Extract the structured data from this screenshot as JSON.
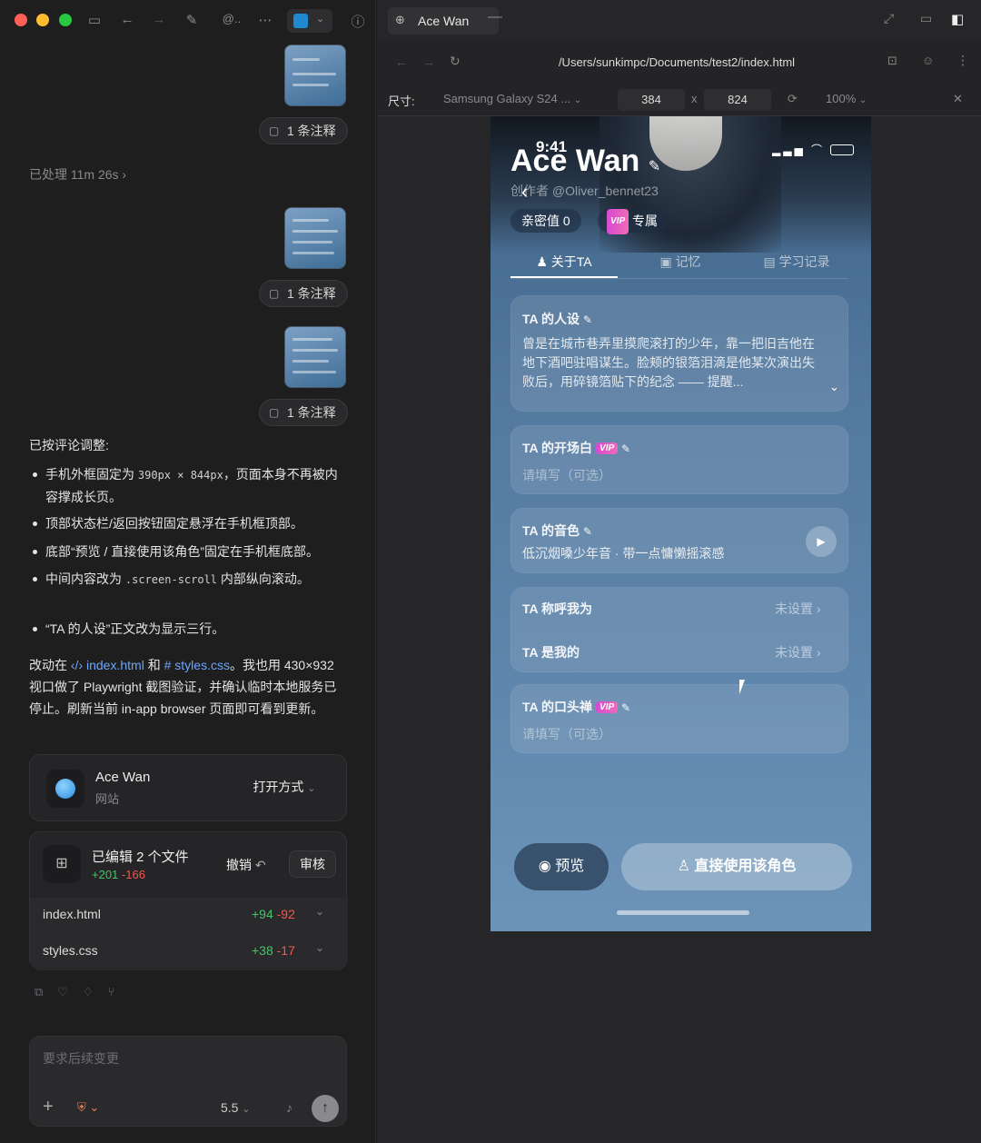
{
  "app": {
    "tab_title": "Ace Wan",
    "url": "/Users/sunkimpc/Documents/test2/index.html"
  },
  "device": {
    "label": "尺寸:",
    "model": "Samsung Galaxy S24 ...",
    "width": "384",
    "times": "x",
    "height": "824",
    "zoom": "100%"
  },
  "left": {
    "comment_label": "1 条注释",
    "processed": "已处理 11m 26s",
    "summary_title": "已按评论调整:",
    "bullets": [
      {
        "pre": "手机外框固定为 ",
        "code": "390px × 844px",
        "post": "，页面本身不再被内容撑成长页。"
      },
      {
        "pre": "顶部状态栏/返回按钮固定悬浮在手机框顶部。",
        "code": "",
        "post": ""
      },
      {
        "pre": "底部“预览 / 直接使用该角色”固定在手机框底部。",
        "code": "",
        "post": ""
      },
      {
        "pre": "中间内容改为 ",
        "code": ".screen-scroll",
        "post": " 内部纵向滚动。"
      },
      {
        "pre": "“TA 的人设”正文改为显示三行。",
        "code": "",
        "post": ""
      }
    ],
    "changes_pre": "改动在 ",
    "file_link_1": "index.html",
    "changes_and": " 和 ",
    "file_link_2": "styles.css",
    "changes_post": "。我也用 430×932 视口做了 Playwright 截图验证，并确认临时本地服务已停止。刷新当前 in-app browser 页面即可看到更新。",
    "site_card": {
      "name": "Ace Wan",
      "type": "网站",
      "open_label": "打开方式"
    },
    "edits": {
      "title": "已编辑 2 个文件",
      "added": "+201",
      "removed": "-166",
      "undo": "撤销",
      "review": "审核",
      "files": [
        {
          "name": "index.html",
          "added": "+94",
          "removed": "-92"
        },
        {
          "name": "styles.css",
          "added": "+38",
          "removed": "-17"
        }
      ]
    },
    "composer": {
      "placeholder": "要求后续变更",
      "model": "5.5"
    }
  },
  "phone": {
    "time": "9:41",
    "name": "Ace Wan",
    "creator": "创作者 @Oliver_bennet23",
    "intimacy": "亲密值 0",
    "vip_badge": "VIP",
    "vip_exclusive": "专属",
    "tabs": [
      "关于TA",
      "记忆",
      "学习记录"
    ],
    "persona": {
      "title": "TA 的人设",
      "text": "曾是在城市巷弄里摸爬滚打的少年，靠一把旧吉他在地下酒吧驻唱谋生。脸颊的银箔泪滴是他某次演出失败后，用碎镜箔贴下的纪念 —— 提醒..."
    },
    "opening": {
      "title": "TA 的开场白",
      "placeholder": "请填写（可选）"
    },
    "voice": {
      "title": "TA 的音色",
      "desc": "低沉烟嗓少年音 · 带一点慵懒摇滚感"
    },
    "call_me": {
      "title": "TA 称呼我为",
      "value": "未设置"
    },
    "is_my": {
      "title": "TA 是我的",
      "value": "未设置"
    },
    "catchphrase": {
      "title": "TA 的口头禅",
      "placeholder": "请填写（可选）"
    },
    "preview_btn": "预览",
    "use_btn": "直接使用该角色"
  }
}
